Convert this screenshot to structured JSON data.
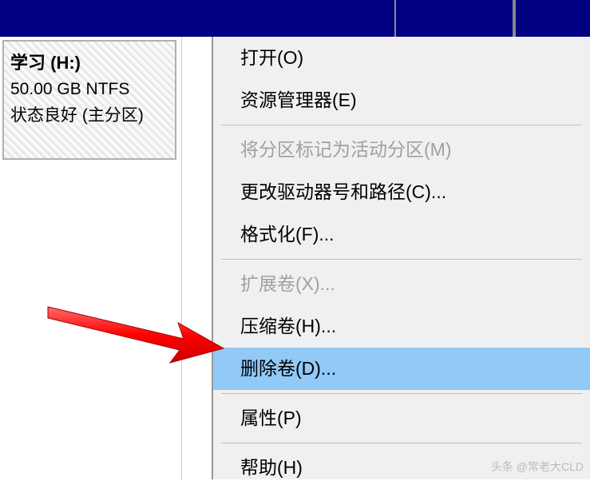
{
  "partition": {
    "title": "学习   (H:)",
    "size": "50.00 GB NTFS",
    "status": "状态良好 (主分区)"
  },
  "menu": {
    "open": "打开(O)",
    "explorer": "资源管理器(E)",
    "mark_active": "将分区标记为活动分区(M)",
    "change_drive": "更改驱动器号和路径(C)...",
    "format": "格式化(F)...",
    "extend": "扩展卷(X)...",
    "shrink": "压缩卷(H)...",
    "delete": "删除卷(D)...",
    "properties": "属性(P)",
    "help": "帮助(H)"
  },
  "watermark": "头条 @常老大CLD"
}
